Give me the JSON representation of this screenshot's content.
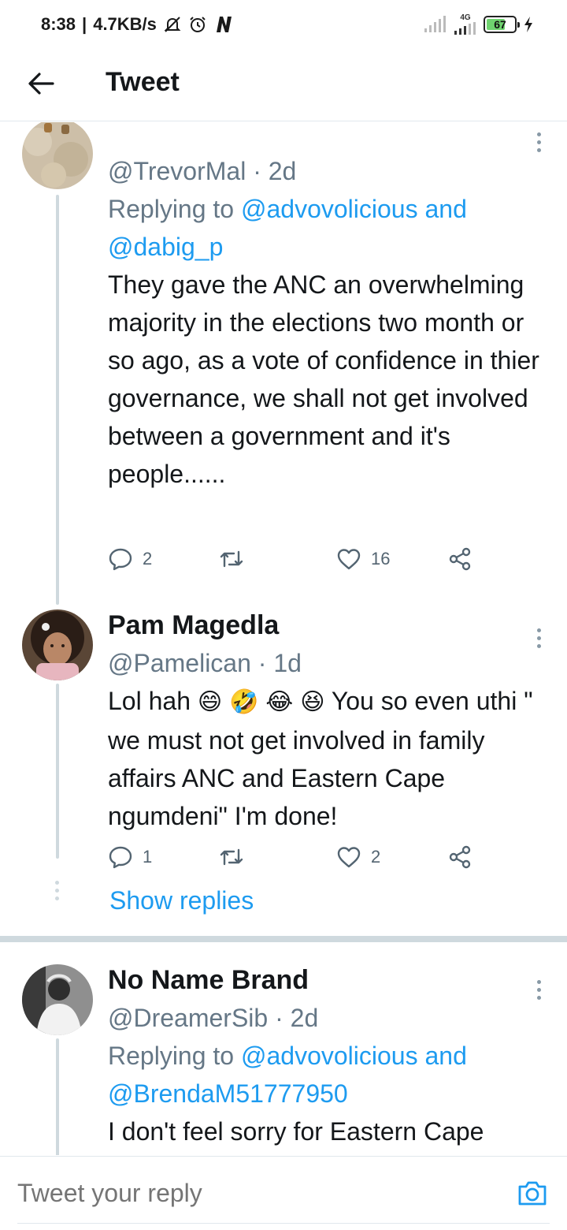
{
  "status_bar": {
    "time": "8:38",
    "net_speed": "4.7KB/s",
    "network_type": "4G",
    "battery_level": "67",
    "battery_fill": 0.67,
    "icons": [
      "mute-icon",
      "alarm-icon",
      "n-app-icon",
      "signal-icon",
      "charging-icon"
    ]
  },
  "header": {
    "title": "Tweet"
  },
  "tweets": [
    {
      "handle": "@TrevorMal",
      "time": "2d",
      "replying_prefix": "Replying to",
      "replying_first": "@advovolicious",
      "replying_and": "and",
      "replying_second": "@dabig_p",
      "text": "They gave the ANC an overwhelming majority in the elections two month or so ago, as a vote of confidence in thier governance, we shall not get involved between a government and it's people......",
      "reply_count": "2",
      "like_count": "16"
    },
    {
      "display_name": "Pam Magedla",
      "handle": "@Pamelican",
      "time": "1d",
      "text_before": "Lol hah",
      "emojis": [
        "😄",
        "🤣",
        "😂",
        "😆"
      ],
      "text_after": "You so even uthi \" we must not get involved in family affairs ANC and Eastern Cape ngumdeni\" I'm done!",
      "reply_count": "1",
      "like_count": "2",
      "show_replies": "Show replies"
    },
    {
      "display_name": "No Name Brand",
      "handle": "@DreamerSib",
      "time": "2d",
      "replying_prefix": "Replying to",
      "replying_first": "@advovolicious",
      "replying_and": "and",
      "replying_second": "@BrendaM51777950",
      "text": "I don't feel sorry for Eastern Cape"
    }
  ],
  "reply_bar": {
    "placeholder": "Tweet your reply"
  },
  "colors": {
    "link": "#1d9bf0",
    "secondary_text": "#657786",
    "thread_line": "#cfd9de"
  }
}
